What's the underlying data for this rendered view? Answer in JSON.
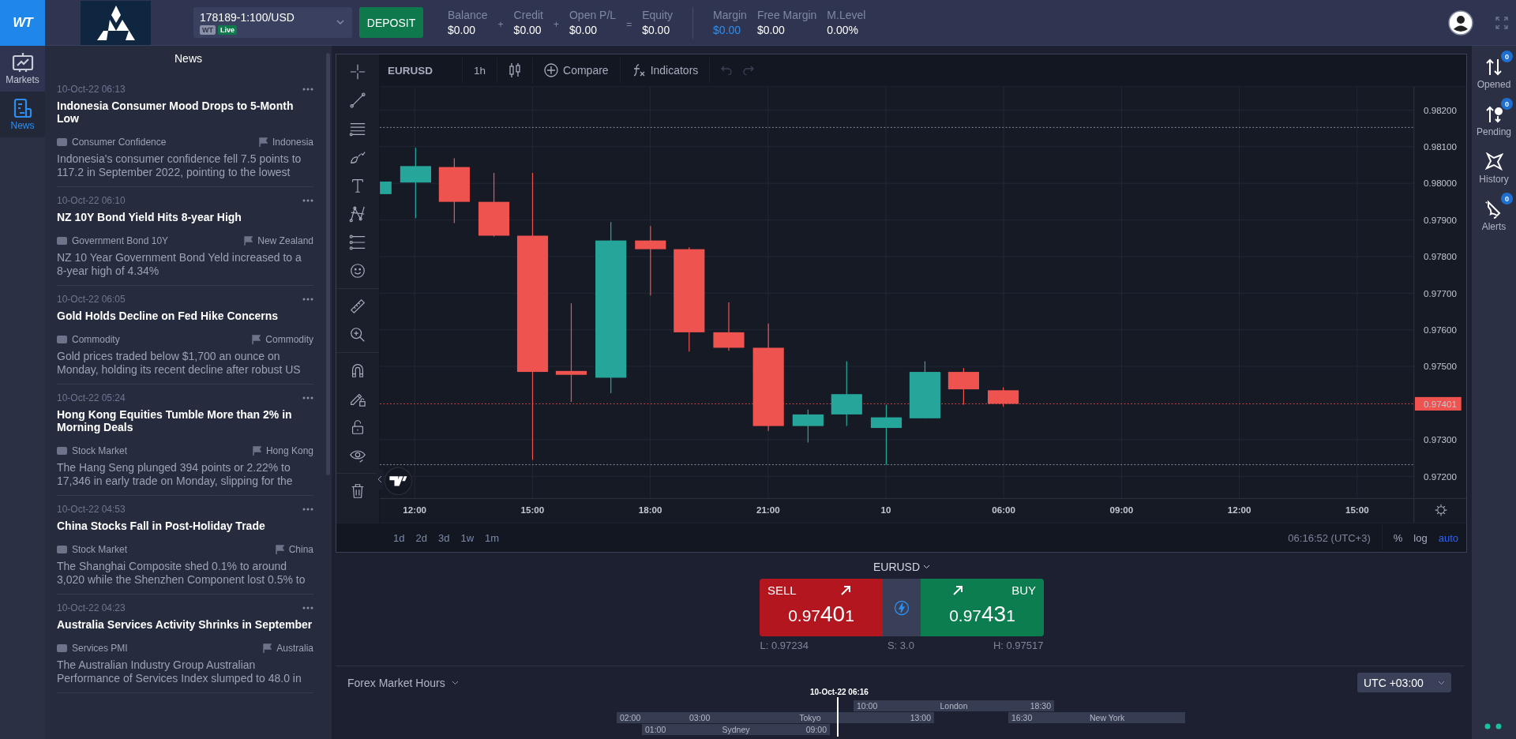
{
  "top_bar": {
    "app_logo": "WT",
    "account": {
      "number": "178189-1:100/USD",
      "badges": [
        {
          "text": "WT",
          "kind": "platform"
        },
        {
          "text": "Live",
          "kind": "live"
        }
      ]
    },
    "deposit_button": "DEPOSIT",
    "stats": [
      {
        "label": "Balance",
        "value": "$0.00",
        "operator": "+"
      },
      {
        "label": "Credit",
        "value": "$0.00",
        "operator": "+"
      },
      {
        "label": "Open P/L",
        "value": "$0.00",
        "operator": "="
      },
      {
        "label": "Equity",
        "value": "$0.00"
      }
    ],
    "margin_stats": [
      {
        "label": "Margin",
        "value": "$0.00",
        "highlight": true
      },
      {
        "label": "Free Margin",
        "value": "$0.00",
        "highlight": false
      },
      {
        "label": "M.Level",
        "value": "0.00%",
        "highlight": false
      }
    ]
  },
  "left_nav": [
    {
      "label": "Markets",
      "selected": false
    },
    {
      "label": "News",
      "selected": true
    }
  ],
  "news": {
    "title": "News",
    "items": [
      {
        "date": "10-Oct-22 06:13",
        "title": "Indonesia Consumer Mood Drops to 5-Month Low",
        "category": "Consumer Confidence",
        "country": "Indonesia",
        "summary": "Indonesia's consumer confidence fell 7.5 points to 117.2 in September 2022, pointing to the lowest"
      },
      {
        "date": "10-Oct-22 06:10",
        "title": "NZ 10Y Bond Yield Hits 8-year High",
        "category": "Government Bond 10Y",
        "country": "New Zealand",
        "summary": "NZ 10 Year Government Bond Yeld increased to a 8-year high of 4.34%"
      },
      {
        "date": "10-Oct-22 06:05",
        "title": "Gold Holds Decline on Fed Hike Concerns",
        "category": "Commodity",
        "country": "Commodity",
        "summary": "Gold prices traded below $1,700 an ounce on Monday, holding its recent decline after robust US"
      },
      {
        "date": "10-Oct-22 05:24",
        "title": "Hong Kong Equities Tumble More than 2% in Morning Deals",
        "category": "Stock Market",
        "country": "Hong Kong",
        "summary": "The Hang Seng plunged 394 points or 2.22% to 17,346 in early trade on Monday, slipping for the"
      },
      {
        "date": "10-Oct-22 04:53",
        "title": "China Stocks Fall in Post-Holiday Trade",
        "category": "Stock Market",
        "country": "China",
        "summary": "The Shanghai Composite shed 0.1% to around 3,020 while the Shenzhen Component lost 0.5% to"
      },
      {
        "date": "10-Oct-22 04:23",
        "title": "Australia Services Activity Shrinks in September",
        "category": "Services PMI",
        "country": "Australia",
        "summary": "The Australian Industry Group Australian Performance of Services Index slumped to 48.0 in"
      }
    ]
  },
  "chart": {
    "symbol": "EURUSD",
    "interval": "1h",
    "toolbar": [
      {
        "kind": "compare",
        "label": "Compare"
      },
      {
        "kind": "indicators",
        "label": "Indicators"
      }
    ],
    "price_axis": [
      "0.98200",
      "0.98100",
      "0.98000",
      "0.97900",
      "0.97800",
      "0.97700",
      "0.97600",
      "0.97500",
      "0.97300",
      "0.97200"
    ],
    "current_price": "0.97401",
    "time_axis": [
      "12:00",
      "15:00",
      "18:00",
      "21:00",
      "10",
      "06:00",
      "09:00",
      "12:00",
      "15:00"
    ],
    "ranges": [
      "1d",
      "2d",
      "3d",
      "1w",
      "1m"
    ],
    "clock": "06:16:52 (UTC+3)",
    "scale_options": [
      {
        "label": "%",
        "selected": false
      },
      {
        "label": "log",
        "selected": false
      },
      {
        "label": "auto",
        "selected": true
      }
    ]
  },
  "trade": {
    "symbol": "EURUSD",
    "sell": {
      "label": "SELL",
      "prefix": "0.97",
      "big": "40",
      "suffix": "1"
    },
    "buy": {
      "label": "BUY",
      "prefix": "0.97",
      "big": "43",
      "suffix": "1"
    },
    "low": "L: 0.97234",
    "spread": "S: 3.0",
    "high": "H: 0.97517"
  },
  "market_hours": {
    "title": "Forex Market Hours",
    "timezone": "UTC +03:00",
    "now": "10-Oct-22 06:16",
    "sessions": [
      {
        "start": "10:00",
        "name": "London",
        "end": "18:30"
      },
      {
        "start": "02:00"
      },
      {
        "start": "03:00",
        "name": "Tokyo",
        "end": "13:00"
      },
      {
        "start": "16:30",
        "name": "New York"
      },
      {
        "start": "01:00",
        "name": "Sydney",
        "end": "09:00"
      }
    ]
  },
  "right_nav": [
    {
      "label": "Opened",
      "badge": "0"
    },
    {
      "label": "Pending",
      "badge": "0"
    },
    {
      "label": "History"
    },
    {
      "label": "Alerts",
      "badge": "0"
    }
  ]
}
